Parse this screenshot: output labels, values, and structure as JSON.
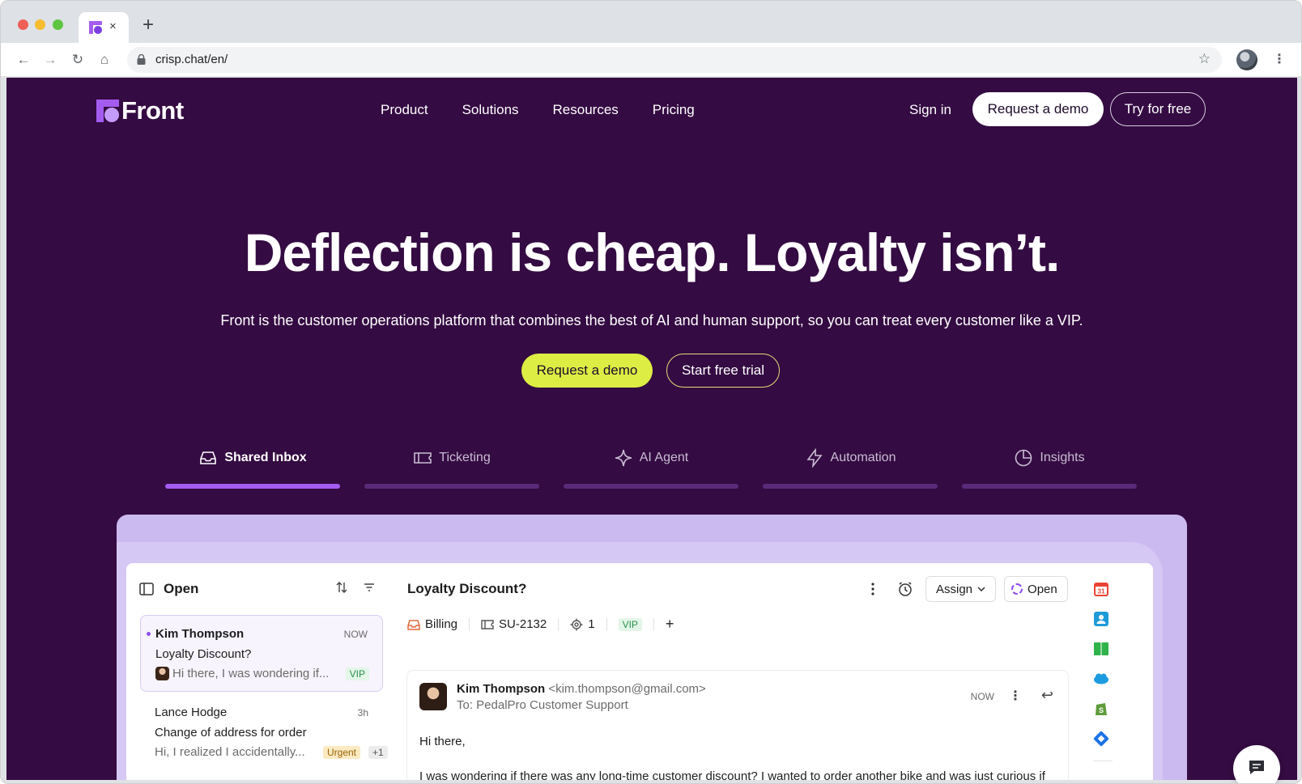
{
  "browser": {
    "tab_close": "×",
    "new_tab": "+",
    "url": "crisp.chat/en/",
    "nav": {
      "back": "←",
      "forward": "→",
      "reload": "↻",
      "home": "⌂"
    },
    "star": "☆",
    "menu": "⋮"
  },
  "header": {
    "logo_text": "Front",
    "nav_items": [
      "Product",
      "Solutions",
      "Resources",
      "Pricing"
    ],
    "sign_in": "Sign in",
    "request_demo": "Request a demo",
    "try_free": "Try for free"
  },
  "hero": {
    "title": "Deflection is cheap. Loyalty isn’t.",
    "subtitle": "Front is the customer operations platform that combines the best of AI and human support, so you can treat every customer like a VIP.",
    "cta_primary": "Request a demo",
    "cta_secondary": "Start free trial"
  },
  "feature_tabs": [
    {
      "label": "Shared Inbox",
      "icon": "inbox-icon",
      "active": true
    },
    {
      "label": "Ticketing",
      "icon": "ticket-icon",
      "active": false
    },
    {
      "label": "AI Agent",
      "icon": "sparkle-icon",
      "active": false
    },
    {
      "label": "Automation",
      "icon": "lightning-icon",
      "active": false
    },
    {
      "label": "Insights",
      "icon": "pie-chart-icon",
      "active": false
    }
  ],
  "demo": {
    "list_title": "Open",
    "conversations": [
      {
        "name": "Kim Thompson",
        "time": "NOW",
        "subject": "Loyalty Discount?",
        "preview": "Hi there, I was wondering if...",
        "tags": [
          "VIP"
        ],
        "unread": true,
        "selected": true
      },
      {
        "name": "Lance Hodge",
        "time": "3h",
        "subject": "Change of address for order",
        "preview": "Hi, I realized I accidentally...",
        "tags": [
          "Urgent",
          "+1"
        ],
        "unread": false,
        "selected": false
      }
    ],
    "message": {
      "title": "Loyalty Discount?",
      "assign": "Assign",
      "status": "Open",
      "meta": {
        "inbox": "Billing",
        "ticket": "SU-2132",
        "count": "1",
        "tag": "VIP",
        "add": "+"
      },
      "from_name": "Kim Thompson",
      "from_email": "<kim.thompson@gmail.com>",
      "to": "To: PedalPro Customer Support",
      "time": "NOW",
      "greeting": "Hi there,",
      "body": "I was wondering if there was any long-time customer discount? I wanted to order another bike and was just curious if"
    },
    "rail_icons": [
      "calendar-icon",
      "contact-icon",
      "book-icon",
      "salesforce-icon",
      "shopify-icon",
      "jira-icon"
    ]
  },
  "colors": {
    "page_bg": "#340b42",
    "accent_purple": "#a45cf0",
    "cta_yellow": "#dded44"
  }
}
